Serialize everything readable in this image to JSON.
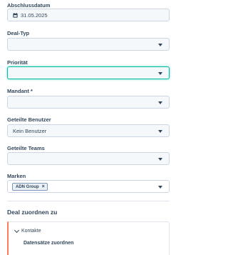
{
  "form": {
    "closing_date": {
      "label": "Abschlussdatum",
      "value": "31.05.2025"
    },
    "deal_type": {
      "label": "Deal-Typ",
      "value": ""
    },
    "priority": {
      "label": "Priorität",
      "value": ""
    },
    "client": {
      "label": "Mandant *",
      "value": ""
    },
    "shared_users": {
      "label": "Geteilte Benutzer",
      "value": "Kein Benutzer"
    },
    "shared_teams": {
      "label": "Geteilte Teams",
      "value": ""
    },
    "brands": {
      "label": "Marken",
      "tags": [
        "ADN Group"
      ],
      "tag_remove": "×"
    }
  },
  "assoc": {
    "title": "Deal zuordnen zu",
    "contacts": {
      "label": "Kontakte",
      "action": "Datensätze zuordnen"
    }
  },
  "icons": {
    "calendar": "calendar-icon",
    "dropdown": "caret-down-icon",
    "expand": "chevron-down-icon"
  },
  "colors": {
    "focus": "#00bda5",
    "accent": "#ff7a59",
    "text": "#33475b",
    "border": "#cbd6e2",
    "input_bg": "#f5f8fa"
  }
}
